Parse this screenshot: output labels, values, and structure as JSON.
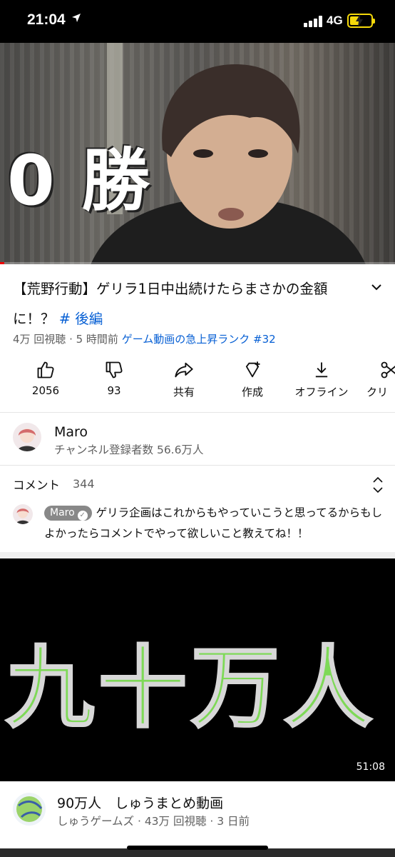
{
  "status_bar": {
    "time": "21:04",
    "network": "4G"
  },
  "video": {
    "overlay_text": "0 勝",
    "progress_percent": 1
  },
  "title": {
    "text": "【荒野行動】ゲリラ1日中出続けたらまさかの金額に！？",
    "hashtag": "# 後編"
  },
  "meta": {
    "views_time": "4万 回視聴 · 5 時間前",
    "trending": "ゲーム動画の急上昇ランク #32"
  },
  "actions": [
    {
      "label": "2056",
      "icon": "thumbs-up-icon"
    },
    {
      "label": "93",
      "icon": "thumbs-down-icon"
    },
    {
      "label": "共有",
      "icon": "share-icon"
    },
    {
      "label": "作成",
      "icon": "create-icon"
    },
    {
      "label": "オフライン",
      "icon": "download-icon"
    },
    {
      "label": "クリ",
      "icon": "clip-icon"
    }
  ],
  "channel": {
    "name": "Maro",
    "subscribers": "チャンネル登録者数 56.6万人"
  },
  "comments": {
    "label": "コメント",
    "count": "344",
    "top_author": "Maro",
    "top_text": "ゲリラ企画はこれからもやっていこうと思ってるからもしよかったらコメントでやって欲しいこと教えてね！！"
  },
  "recommended": {
    "thumbnail_text": "九十万人",
    "duration": "51:08",
    "title": "90万人　しゅうまとめ動画",
    "meta": "しゅうゲームズ · 43万 回視聴 · 3 日前"
  },
  "colors": {
    "link": "#065fd4",
    "secondary_text": "#606060",
    "thumb_text": "#7ed957"
  }
}
